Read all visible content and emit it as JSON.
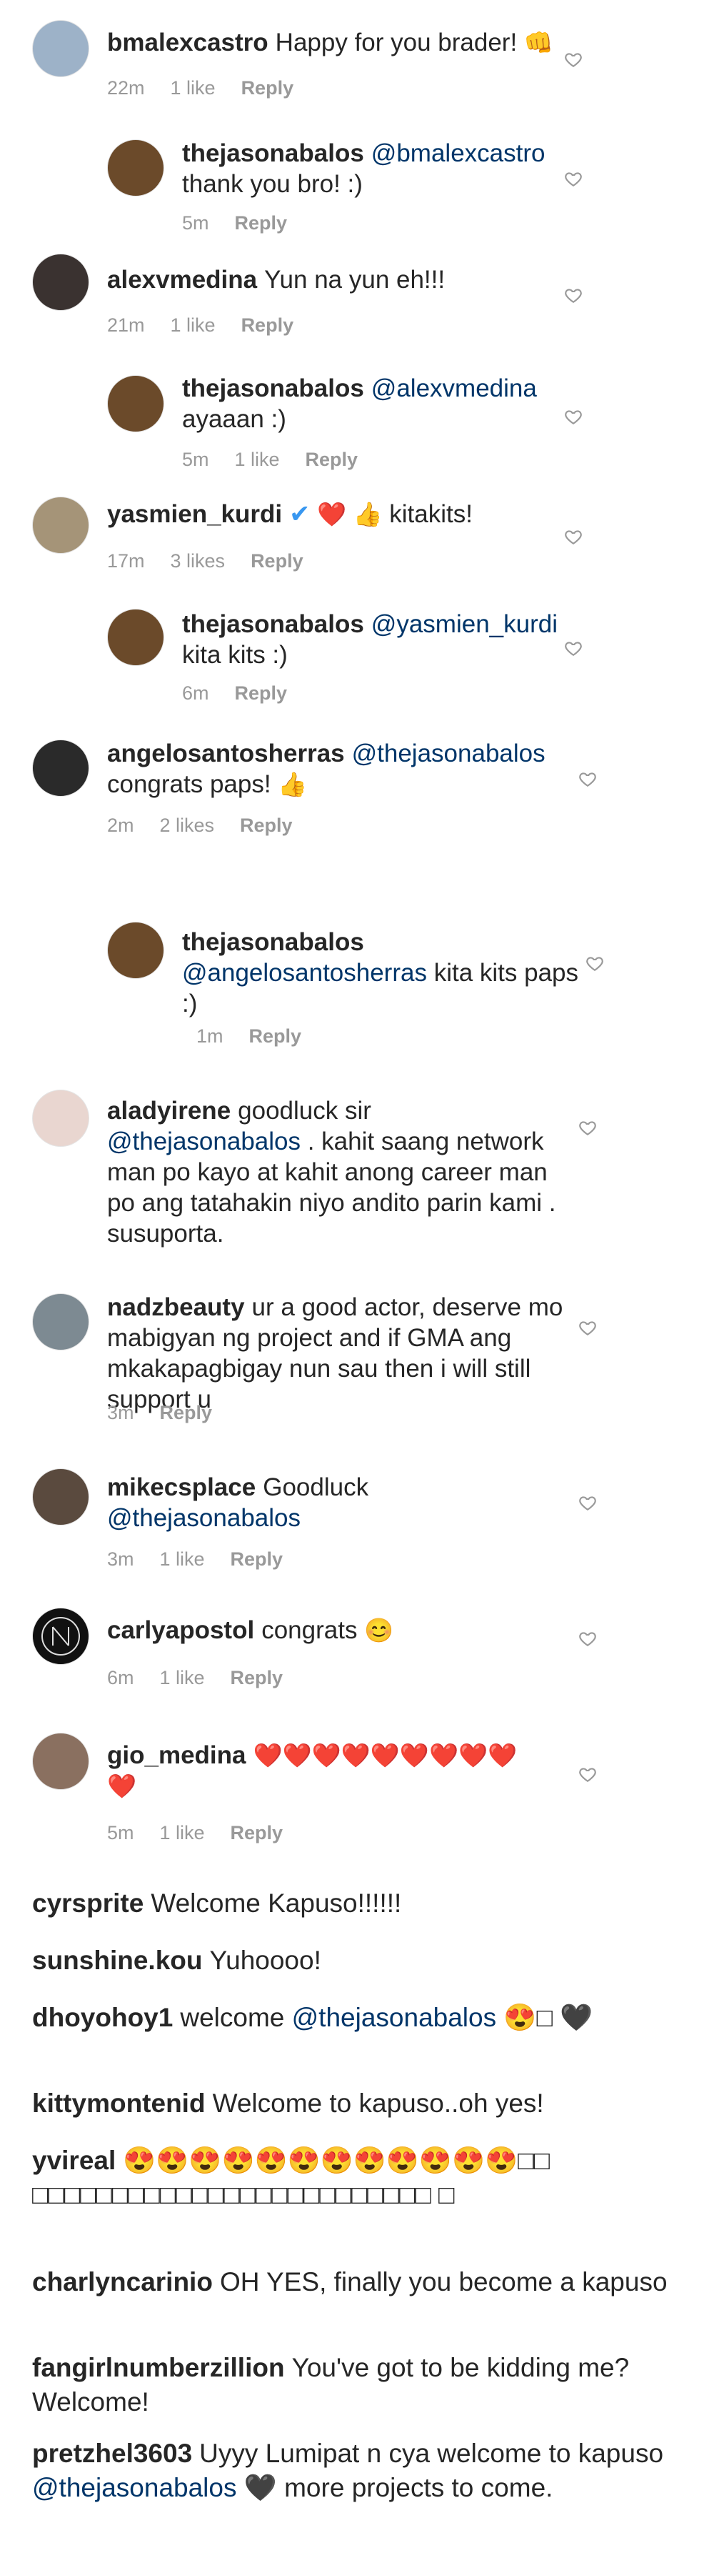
{
  "comments": [
    {
      "user": "bmalexcastro",
      "text": "Happy for you brader!",
      "emoji": "👊",
      "time": "22m",
      "likes": "1 like",
      "reply": "Reply"
    },
    {
      "user": "thejasonabalos",
      "mention": "@bmalexcastro",
      "text": "thank you bro! :)",
      "time": "5m",
      "reply": "Reply"
    },
    {
      "user": "alexvmedina",
      "text": "Yun na yun eh!!!",
      "time": "21m",
      "likes": "1 like",
      "reply": "Reply"
    },
    {
      "user": "thejasonabalos",
      "mention": "@alexvmedina",
      "text": "ayaaan :)",
      "time": "5m",
      "likes": "1 like",
      "reply": "Reply"
    },
    {
      "user": "yasmien_kurdi",
      "badge": "✔",
      "emoji": "❤️ 👍",
      "text": "kitakits!",
      "time": "17m",
      "likes": "3 likes",
      "reply": "Reply"
    },
    {
      "user": "thejasonabalos",
      "mention": "@yasmien_kurdi",
      "text": "kita kits :)",
      "time": "6m",
      "reply": "Reply"
    },
    {
      "user": "angelosantosherras",
      "mention": "@thejasonabalos",
      "text": "congrats paps!",
      "emoji": "👍",
      "time": "2m",
      "likes": "2 likes",
      "reply": "Reply"
    },
    {
      "user": "thejasonabalos",
      "mention": "@angelosantosherras",
      "text": "kita kits paps :)",
      "time": "1m",
      "reply": "Reply"
    },
    {
      "user": "aladyirene",
      "text_a": "goodluck sir",
      "mention": "@thejasonabalos",
      "text_b": ". kahit saang network man po kayo at kahit anong career man po ang tatahakin niyo andito parin kami . susuporta."
    },
    {
      "user": "nadzbeauty",
      "text": "ur a good actor, deserve mo mabigyan ng project and if GMA ang mkakapagbigay nun sau then i will still support u",
      "time": "3m",
      "reply": "Reply"
    },
    {
      "user": "mikecsplace",
      "text": "Goodluck",
      "mention": "@thejasonabalos",
      "time": "3m",
      "likes": "1 like",
      "reply": "Reply"
    },
    {
      "user": "carlyapostol",
      "text": "congrats",
      "emoji": "😊",
      "time": "6m",
      "likes": "1 like",
      "reply": "Reply"
    },
    {
      "user": "gio_medina",
      "emoji": "❤️❤️❤️❤️❤️❤️❤️❤️❤️ ❤️",
      "time": "5m",
      "likes": "1 like",
      "reply": "Reply"
    }
  ],
  "plain": [
    {
      "user": "cyrsprite",
      "text": "Welcome Kapuso!!!!!!"
    },
    {
      "user": "sunshine.kou",
      "text": "Yuhoooo!"
    },
    {
      "user": "dhoyohoy1",
      "text_a": "welcome",
      "mention": "@thejasonabalos",
      "text_b": "😍□ 🖤"
    },
    {
      "user": "kittymontenid",
      "text": "Welcome to kapuso..oh yes!"
    },
    {
      "user": "yvireal",
      "text": "😍😍😍😍😍😍😍😍😍😍😍😍□□ □□□□□□□□□□□□□□□□□□□□□□□□□ □"
    },
    {
      "user": "charlyncarinio",
      "text": "OH YES, finally you become a kapuso"
    },
    {
      "user": "fangirlnumberzillion",
      "text": "You've got to be kidding me? Welcome!"
    },
    {
      "user": "pretzhel3603",
      "text_a": "Uyyy Lumipat n cya welcome to kapuso",
      "mention": "@thejasonabalos",
      "text_b": "🖤 more projects to come."
    }
  ],
  "colors": {
    "text": "#262626",
    "meta": "#999999",
    "mention": "#003569",
    "heart": "#999999"
  }
}
